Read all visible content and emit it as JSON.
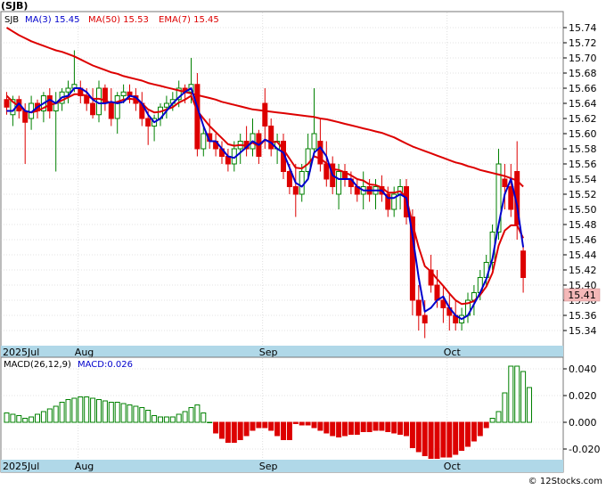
{
  "chart_data": [
    {
      "type": "candlestick",
      "title": "(SJB)",
      "legend": {
        "symbol": "SJB",
        "items": [
          {
            "label": "MA(3)",
            "value": "15.45",
            "color": "#0000cc"
          },
          {
            "label": "MA(50)",
            "value": "15.53",
            "color": "#dd0000"
          },
          {
            "label": "EMA(7)",
            "value": "15.45",
            "color": "#dd0000"
          }
        ]
      },
      "ylim": [
        15.32,
        15.76
      ],
      "y_ticks": [
        "15.74",
        "15.72",
        "15.70",
        "15.68",
        "15.66",
        "15.64",
        "15.62",
        "15.60",
        "15.58",
        "15.56",
        "15.54",
        "15.52",
        "15.50",
        "15.48",
        "15.46",
        "15.44",
        "15.42",
        "15.40",
        "15.38",
        "15.36",
        "15.34"
      ],
      "x_labels": [
        {
          "label": "2025Jul",
          "index": 0
        },
        {
          "label": "Aug",
          "index": 12
        },
        {
          "label": "Sep",
          "index": 42
        },
        {
          "label": "Oct",
          "index": 72
        }
      ],
      "last_price": "15.41",
      "colors": {
        "up": "#008000",
        "down": "#dd0000",
        "ma3": "#0000cc",
        "ma50": "#dd0000",
        "ema7": "#dd0000",
        "axis_band": "#b0d8e8",
        "price_tag": "#f4b8b8"
      },
      "candles": [
        [
          15.645,
          15.655,
          15.625,
          15.635
        ],
        [
          15.625,
          15.65,
          15.61,
          15.645
        ],
        [
          15.645,
          15.65,
          15.62,
          15.63
        ],
        [
          15.63,
          15.64,
          15.56,
          15.615
        ],
        [
          15.62,
          15.65,
          15.605,
          15.64
        ],
        [
          15.64,
          15.645,
          15.62,
          15.63
        ],
        [
          15.63,
          15.655,
          15.615,
          15.65
        ],
        [
          15.65,
          15.66,
          15.62,
          15.63
        ],
        [
          15.63,
          15.655,
          15.55,
          15.64
        ],
        [
          15.64,
          15.66,
          15.63,
          15.655
        ],
        [
          15.655,
          15.67,
          15.64,
          15.66
        ],
        [
          15.66,
          15.71,
          15.655,
          15.665
        ],
        [
          15.66,
          15.67,
          15.64,
          15.65
        ],
        [
          15.65,
          15.66,
          15.63,
          15.64
        ],
        [
          15.64,
          15.66,
          15.62,
          15.625
        ],
        [
          15.625,
          15.67,
          15.615,
          15.66
        ],
        [
          15.66,
          15.665,
          15.63,
          15.64
        ],
        [
          15.64,
          15.66,
          15.61,
          15.62
        ],
        [
          15.62,
          15.655,
          15.6,
          15.65
        ],
        [
          15.65,
          15.665,
          15.64,
          15.655
        ],
        [
          15.655,
          15.665,
          15.64,
          15.65
        ],
        [
          15.65,
          15.66,
          15.63,
          15.64
        ],
        [
          15.64,
          15.655,
          15.61,
          15.62
        ],
        [
          15.62,
          15.63,
          15.585,
          15.61
        ],
        [
          15.61,
          15.625,
          15.59,
          15.62
        ],
        [
          15.62,
          15.64,
          15.61,
          15.635
        ],
        [
          15.635,
          15.65,
          15.62,
          15.64
        ],
        [
          15.64,
          15.655,
          15.63,
          15.645
        ],
        [
          15.645,
          15.67,
          15.635,
          15.66
        ],
        [
          15.66,
          15.665,
          15.64,
          15.655
        ],
        [
          15.655,
          15.7,
          15.64,
          15.665
        ],
        [
          15.665,
          15.68,
          15.57,
          15.58
        ],
        [
          15.58,
          15.61,
          15.57,
          15.6
        ],
        [
          15.6,
          15.62,
          15.58,
          15.59
        ],
        [
          15.59,
          15.6,
          15.57,
          15.58
        ],
        [
          15.58,
          15.59,
          15.56,
          15.57
        ],
        [
          15.57,
          15.58,
          15.55,
          15.56
        ],
        [
          15.56,
          15.59,
          15.55,
          15.58
        ],
        [
          15.58,
          15.6,
          15.56,
          15.59
        ],
        [
          15.59,
          15.61,
          15.57,
          15.58
        ],
        [
          15.58,
          15.62,
          15.57,
          15.6
        ],
        [
          15.6,
          15.605,
          15.56,
          15.57
        ],
        [
          15.64,
          15.66,
          15.58,
          15.61
        ],
        [
          15.61,
          15.62,
          15.57,
          15.58
        ],
        [
          15.58,
          15.6,
          15.56,
          15.59
        ],
        [
          15.59,
          15.6,
          15.54,
          15.55
        ],
        [
          15.55,
          15.56,
          15.52,
          15.53
        ],
        [
          15.53,
          15.56,
          15.49,
          15.52
        ],
        [
          15.52,
          15.56,
          15.51,
          15.55
        ],
        [
          15.55,
          15.6,
          15.54,
          15.58
        ],
        [
          15.58,
          15.66,
          15.57,
          15.6
        ],
        [
          15.59,
          15.62,
          15.55,
          15.56
        ],
        [
          15.56,
          15.59,
          15.53,
          15.54
        ],
        [
          15.56,
          15.57,
          15.52,
          15.53
        ],
        [
          15.52,
          15.56,
          15.5,
          15.55
        ],
        [
          15.55,
          15.56,
          15.53,
          15.54
        ],
        [
          15.54,
          15.55,
          15.52,
          15.53
        ],
        [
          15.53,
          15.54,
          15.51,
          15.52
        ],
        [
          15.52,
          15.55,
          15.5,
          15.53
        ],
        [
          15.53,
          15.54,
          15.51,
          15.52
        ],
        [
          15.52,
          15.54,
          15.5,
          15.53
        ],
        [
          15.53,
          15.545,
          15.51,
          15.52
        ],
        [
          15.52,
          15.53,
          15.49,
          15.5
        ],
        [
          15.5,
          15.53,
          15.49,
          15.52
        ],
        [
          15.52,
          15.54,
          15.5,
          15.53
        ],
        [
          15.53,
          15.54,
          15.48,
          15.49
        ],
        [
          15.49,
          15.5,
          15.36,
          15.38
        ],
        [
          15.38,
          15.4,
          15.34,
          15.36
        ],
        [
          15.36,
          15.38,
          15.33,
          15.35
        ],
        [
          15.42,
          15.44,
          15.39,
          15.4
        ],
        [
          15.4,
          15.42,
          15.37,
          15.38
        ],
        [
          15.38,
          15.4,
          15.35,
          15.37
        ],
        [
          15.37,
          15.39,
          15.34,
          15.36
        ],
        [
          15.36,
          15.38,
          15.34,
          15.35
        ],
        [
          15.35,
          15.37,
          15.34,
          15.36
        ],
        [
          15.36,
          15.39,
          15.35,
          15.38
        ],
        [
          15.38,
          15.4,
          15.36,
          15.39
        ],
        [
          15.39,
          15.42,
          15.38,
          15.41
        ],
        [
          15.41,
          15.44,
          15.4,
          15.43
        ],
        [
          15.43,
          15.48,
          15.42,
          15.47
        ],
        [
          15.47,
          15.58,
          15.46,
          15.56
        ],
        [
          15.54,
          15.56,
          15.5,
          15.53
        ],
        [
          15.53,
          15.56,
          15.49,
          15.5
        ],
        [
          15.55,
          15.59,
          15.46,
          15.48
        ],
        [
          15.445,
          15.45,
          15.39,
          15.41
        ]
      ],
      "ma3": [
        15.63,
        15.63,
        15.64,
        15.63,
        15.628,
        15.635,
        15.64,
        15.645,
        15.64,
        15.648,
        15.65,
        15.66,
        15.66,
        15.655,
        15.645,
        15.64,
        15.64,
        15.642,
        15.64,
        15.642,
        15.65,
        15.648,
        15.64,
        15.625,
        15.615,
        15.62,
        15.63,
        15.64,
        15.648,
        15.655,
        15.66,
        15.635,
        15.61,
        15.59,
        15.59,
        15.58,
        15.57,
        15.568,
        15.575,
        15.582,
        15.59,
        15.585,
        15.592,
        15.588,
        15.58,
        15.575,
        15.555,
        15.535,
        15.53,
        15.54,
        15.575,
        15.582,
        15.57,
        15.545,
        15.54,
        15.54,
        15.54,
        15.53,
        15.525,
        15.525,
        15.525,
        15.525,
        15.515,
        15.515,
        15.52,
        15.515,
        15.465,
        15.41,
        15.365,
        15.37,
        15.38,
        15.385,
        15.37,
        15.36,
        15.355,
        15.36,
        15.375,
        15.39,
        15.408,
        15.435,
        15.48,
        15.52,
        15.54,
        15.505,
        15.45
      ],
      "ma50": [
        15.74,
        15.735,
        15.73,
        15.726,
        15.722,
        15.719,
        15.716,
        15.713,
        15.71,
        15.708,
        15.705,
        15.702,
        15.698,
        15.694,
        15.69,
        15.687,
        15.684,
        15.681,
        15.679,
        15.676,
        15.674,
        15.672,
        15.67,
        15.667,
        15.665,
        15.663,
        15.661,
        15.659,
        15.657,
        15.655,
        15.653,
        15.651,
        15.649,
        15.647,
        15.645,
        15.642,
        15.64,
        15.638,
        15.636,
        15.634,
        15.632,
        15.631,
        15.63,
        15.629,
        15.628,
        15.627,
        15.626,
        15.625,
        15.624,
        15.623,
        15.622,
        15.62,
        15.619,
        15.617,
        15.615,
        15.613,
        15.611,
        15.609,
        15.607,
        15.605,
        15.603,
        15.601,
        15.598,
        15.595,
        15.591,
        15.587,
        15.583,
        15.58,
        15.577,
        15.574,
        15.571,
        15.568,
        15.565,
        15.562,
        15.56,
        15.557,
        15.555,
        15.552,
        15.55,
        15.548,
        15.546,
        15.544,
        15.541,
        15.538,
        15.53
      ],
      "ema7": [
        15.65,
        15.642,
        15.636,
        15.63,
        15.628,
        15.63,
        15.634,
        15.638,
        15.64,
        15.644,
        15.648,
        15.652,
        15.652,
        15.65,
        15.646,
        15.646,
        15.644,
        15.64,
        15.642,
        15.645,
        15.646,
        15.645,
        15.64,
        15.632,
        15.628,
        15.629,
        15.632,
        15.635,
        15.641,
        15.645,
        15.65,
        15.63,
        15.62,
        15.61,
        15.602,
        15.594,
        15.586,
        15.584,
        15.585,
        15.584,
        15.588,
        15.583,
        15.592,
        15.589,
        15.589,
        15.579,
        15.567,
        15.555,
        15.554,
        15.56,
        15.57,
        15.567,
        15.561,
        15.553,
        15.552,
        15.549,
        15.545,
        15.54,
        15.538,
        15.533,
        15.532,
        15.529,
        15.522,
        15.522,
        15.524,
        15.515,
        15.481,
        15.45,
        15.425,
        15.418,
        15.408,
        15.399,
        15.389,
        15.38,
        15.375,
        15.376,
        15.379,
        15.387,
        15.398,
        15.416,
        15.452,
        15.472,
        15.479,
        15.479,
        15.462
      ]
    },
    {
      "type": "bar",
      "title": "MACD(26,12,9)",
      "legend": {
        "label": "MACD",
        "value": "0.026",
        "color": "#0000cc"
      },
      "ylim": [
        -0.028,
        0.048
      ],
      "y_ticks": [
        "0.040",
        "0.020",
        "0.000",
        "-0.020"
      ],
      "x_labels": [
        {
          "label": "2025Jul",
          "index": 0
        },
        {
          "label": "Aug",
          "index": 12
        },
        {
          "label": "Sep",
          "index": 42
        },
        {
          "label": "Oct",
          "index": 72
        }
      ],
      "colors": {
        "up": "#008000",
        "down": "#dd0000",
        "axis_band": "#b0d8e8"
      },
      "values": [
        0.007,
        0.006,
        0.005,
        0.003,
        0.004,
        0.006,
        0.008,
        0.01,
        0.012,
        0.015,
        0.017,
        0.018,
        0.019,
        0.019,
        0.018,
        0.017,
        0.016,
        0.015,
        0.015,
        0.014,
        0.013,
        0.012,
        0.011,
        0.009,
        0.005,
        0.004,
        0.004,
        0.004,
        0.006,
        0.008,
        0.011,
        0.013,
        0.007,
        0.0,
        -0.008,
        -0.012,
        -0.015,
        -0.015,
        -0.013,
        -0.01,
        -0.006,
        -0.004,
        -0.004,
        -0.006,
        -0.01,
        -0.013,
        -0.013,
        -0.001,
        -0.002,
        -0.002,
        -0.004,
        -0.006,
        -0.008,
        -0.01,
        -0.011,
        -0.01,
        -0.009,
        -0.009,
        -0.007,
        -0.007,
        -0.006,
        -0.006,
        -0.007,
        -0.008,
        -0.009,
        -0.01,
        -0.019,
        -0.022,
        -0.025,
        -0.027,
        -0.027,
        -0.026,
        -0.026,
        -0.024,
        -0.021,
        -0.018,
        -0.014,
        -0.01,
        -0.004,
        0.003,
        0.008,
        0.022,
        0.042,
        0.042,
        0.038,
        0.026
      ]
    }
  ],
  "footer": {
    "copyright": "© 12Stocks.com"
  }
}
